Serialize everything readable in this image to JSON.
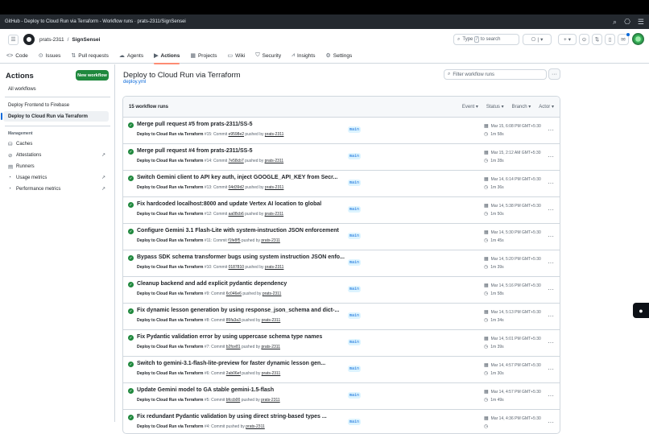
{
  "window": {
    "title": "GitHub - Deploy to Cloud Run via Terraform - Workflow runs · prats-2311/SignSensei"
  },
  "header": {
    "owner": "prats-2311",
    "separator": "/",
    "repo": "SignSensei",
    "search_placeholder": "Type",
    "search_key": "/",
    "search_suffix": "to search"
  },
  "repo_nav": [
    {
      "icon": "code-icon",
      "glyph": "<>",
      "label": "Code"
    },
    {
      "icon": "issues-icon",
      "glyph": "⊙",
      "label": "Issues"
    },
    {
      "icon": "pull-request-icon",
      "glyph": "⇅",
      "label": "Pull requests"
    },
    {
      "icon": "agents-icon",
      "glyph": "☁",
      "label": "Agents"
    },
    {
      "icon": "actions-icon",
      "glyph": "▶",
      "label": "Actions"
    },
    {
      "icon": "projects-icon",
      "glyph": "▦",
      "label": "Projects"
    },
    {
      "icon": "wiki-icon",
      "glyph": "▭",
      "label": "Wiki"
    },
    {
      "icon": "security-icon",
      "glyph": "⛉",
      "label": "Security"
    },
    {
      "icon": "insights-icon",
      "glyph": "⩘",
      "label": "Insights"
    },
    {
      "icon": "settings-icon",
      "glyph": "⚙",
      "label": "Settings"
    }
  ],
  "sidebar": {
    "title": "Actions",
    "new_workflow": "New workflow",
    "all_workflows": "All workflows",
    "workflows": [
      "Deploy Frontend to Firebase",
      "Deploy to Cloud Run via Terraform"
    ],
    "management_heading": "Management",
    "management": [
      {
        "icon": "caches-icon",
        "glyph": "⛁",
        "label": "Caches",
        "ext": ""
      },
      {
        "icon": "attestations-icon",
        "glyph": "⊘",
        "label": "Attestations",
        "ext": "↗"
      },
      {
        "icon": "runners-icon",
        "glyph": "▤",
        "label": "Runners",
        "ext": ""
      },
      {
        "icon": "usage-metrics-icon",
        "glyph": "◔",
        "label": "Usage metrics",
        "ext": "↗"
      },
      {
        "icon": "performance-metrics-icon",
        "glyph": "◔",
        "label": "Performance metrics",
        "ext": "↗"
      }
    ]
  },
  "main": {
    "title": "Deploy to Cloud Run via Terraform",
    "file": "deploy.yml",
    "filter_placeholder": "Filter workflow runs",
    "runs_count": "15 workflow runs",
    "filters": [
      "Event",
      "Status",
      "Branch",
      "Actor"
    ]
  },
  "runs": [
    {
      "title": "Merge pull request #5 from prats-2311/SS-5",
      "workflow": "Deploy to Cloud Run via Terraform",
      "number": "#15",
      "commit": "e9598e2",
      "actor": "prats-2311",
      "branch": "main",
      "date": "Mar 15, 6:08 PM GMT+5:30",
      "duration": "1m 58s"
    },
    {
      "title": "Merge pull request #4 from prats-2311/SS-5",
      "workflow": "Deploy to Cloud Run via Terraform",
      "number": "#14",
      "commit": "7e58cb7",
      "actor": "prats-2311",
      "branch": "main",
      "date": "Mar 15, 2:12 AM GMT+5:30",
      "duration": "1m 28s"
    },
    {
      "title": "Switch Gemini client to API key auth, inject GOOGLE_API_KEY from Secr...",
      "workflow": "Deploy to Cloud Run via Terraform",
      "number": "#13",
      "commit": "04d39d2",
      "actor": "prats-2311",
      "branch": "main",
      "date": "Mar 14, 6:14 PM GMT+5:30",
      "duration": "1m 36s"
    },
    {
      "title": "Fix hardcoded localhost:8000 and update Vertex AI location to global",
      "workflow": "Deploy to Cloud Run via Terraform",
      "number": "#12",
      "commit": "aa08cb6",
      "actor": "prats-2311",
      "branch": "main",
      "date": "Mar 14, 5:38 PM GMT+5:30",
      "duration": "1m 50s"
    },
    {
      "title": "Configure Gemini 3.1 Flash-Lite with system-instruction JSON enforcement",
      "workflow": "Deploy to Cloud Run via Terraform",
      "number": "#11",
      "commit": "f1fe8f5",
      "actor": "prats-2311",
      "branch": "main",
      "date": "Mar 14, 5:30 PM GMT+5:30",
      "duration": "1m 45s"
    },
    {
      "title": "Bypass SDK schema transformer bugs using system instruction JSON enfo...",
      "workflow": "Deploy to Cloud Run via Terraform",
      "number": "#10",
      "commit": "0187810",
      "actor": "prats-2311",
      "branch": "main",
      "date": "Mar 14, 5:20 PM GMT+5:30",
      "duration": "1m 39s"
    },
    {
      "title": "Cleanup backend and add explicit pydantic dependency",
      "workflow": "Deploy to Cloud Run via Terraform",
      "number": "#9",
      "commit": "6c046e6",
      "actor": "prats-2311",
      "branch": "main",
      "date": "Mar 14, 5:16 PM GMT+5:30",
      "duration": "1m 58s"
    },
    {
      "title": "Fix dynamic lesson generation by using response_json_schema and dict-...",
      "workflow": "Deploy to Cloud Run via Terraform",
      "number": "#8",
      "commit": "85fa3a3",
      "actor": "prats-2311",
      "branch": "main",
      "date": "Mar 14, 5:13 PM GMT+5:30",
      "duration": "1m 34s"
    },
    {
      "title": "Fix Pydantic validation error by using uppercase schema type names",
      "workflow": "Deploy to Cloud Run via Terraform",
      "number": "#7",
      "commit": "b2fce81",
      "actor": "prats-2311",
      "branch": "main",
      "date": "Mar 14, 5:01 PM GMT+5:30",
      "duration": "1m 39s"
    },
    {
      "title": "Switch to gemini-3.1-flash-lite-preview for faster dynamic lesson gen...",
      "workflow": "Deploy to Cloud Run via Terraform",
      "number": "#6",
      "commit": "2ab06ef",
      "actor": "prats-2311",
      "branch": "main",
      "date": "Mar 14, 4:57 PM GMT+5:30",
      "duration": "1m 30s"
    },
    {
      "title": "Update Gemini model to GA stable gemini-1.5-flash",
      "workflow": "Deploy to Cloud Run via Terraform",
      "number": "#5",
      "commit": "bfccb00",
      "actor": "prats-2311",
      "branch": "main",
      "date": "Mar 14, 4:57 PM GMT+5:30",
      "duration": "1m 49s"
    },
    {
      "title": "Fix redundant Pydantic validation by using direct string-based types ...",
      "workflow": "Deploy to Cloud Run via Terraform",
      "number": "#4",
      "commit": "",
      "actor": "prats-2311",
      "branch": "main",
      "date": "Mar 14, 4:36 PM GMT+5:30",
      "duration": ""
    }
  ],
  "strings": {
    "commit": "Commit",
    "pushed_by": "pushed by"
  },
  "colors": {
    "success": "#1f883d",
    "accent": "#0969da",
    "primary_button": "#1f883d",
    "active_tab_underline": "#fd8c73"
  }
}
